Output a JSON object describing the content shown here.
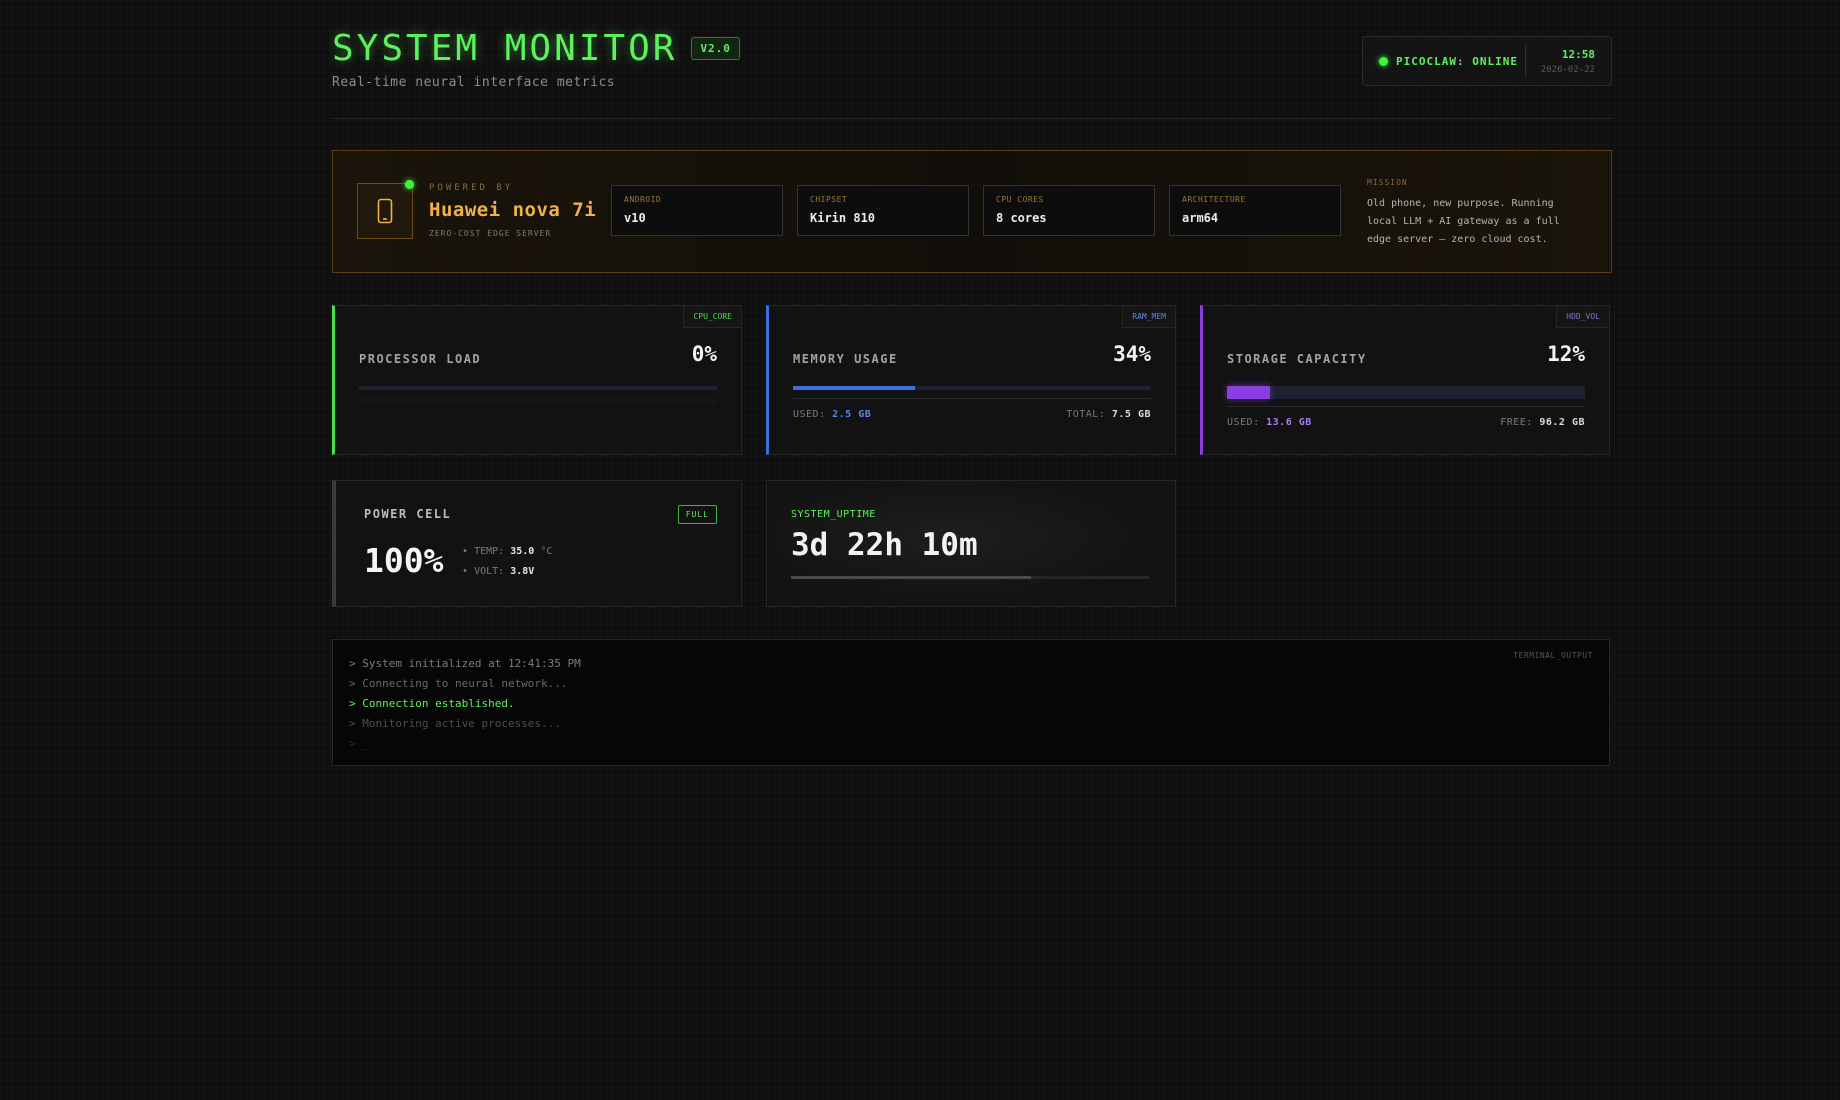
{
  "header": {
    "title": "SYSTEM MONITOR",
    "version": "V2.0",
    "subtitle": "Real-time neural interface metrics",
    "status": "PICOCLAW: ONLINE",
    "time": "12:58",
    "date": "2026-02-22"
  },
  "device": {
    "powered_by": "POWERED BY",
    "name": "Huawei nova 7i",
    "subtitle": "ZERO-COST EDGE SERVER",
    "specs": [
      {
        "label": "ANDROID",
        "value": "v10"
      },
      {
        "label": "CHIPSET",
        "value": "Kirin 810"
      },
      {
        "label": "CPU CORES",
        "value": "8 cores"
      },
      {
        "label": "ARCHITECTURE",
        "value": "arm64"
      }
    ],
    "mission_label": "MISSION",
    "mission_text": "Old phone, new purpose. Running local LLM + AI gateway as a full edge server — zero cloud cost."
  },
  "cpu": {
    "tag": "CPU_CORE",
    "title": "PROCESSOR LOAD",
    "value": "0%",
    "level": 0
  },
  "memory": {
    "tag": "RAM_MEM",
    "title": "MEMORY USAGE",
    "value": "34%",
    "level": 0.34,
    "used_label": "USED:",
    "used_value": "2.5 GB",
    "total_label": "TOTAL:",
    "total_value": "7.5 GB"
  },
  "storage": {
    "tag": "HDD_VOL",
    "title": "STORAGE CAPACITY",
    "value": "12%",
    "level": 0.12,
    "used_label": "USED:",
    "used_value": "13.6 GB",
    "free_label": "FREE:",
    "free_value": "96.2 GB"
  },
  "power": {
    "title": "POWER CELL",
    "badge": "FULL",
    "value": "100%",
    "temp_label": "TEMP:",
    "temp_value": "35.0",
    "temp_unit": "°C",
    "volt_label": "VOLT:",
    "volt_value": "3.8V"
  },
  "uptime": {
    "label": "SYSTEM_UPTIME",
    "value": "3d 22h 10m",
    "level": 0.67
  },
  "terminal": {
    "tag": "TERMINAL_OUTPUT",
    "lines": [
      "> System initialized at 12:41:35 PM",
      "> Connecting to neural network...",
      "> Connection established.",
      "> Monitoring active processes...",
      "> _"
    ]
  },
  "colors": {
    "accent_green": "#5df25d",
    "cpu": "#4ade4a",
    "memory": "#3b6fe0",
    "storage": "#8a3ee0",
    "device": "#f0b14a"
  }
}
